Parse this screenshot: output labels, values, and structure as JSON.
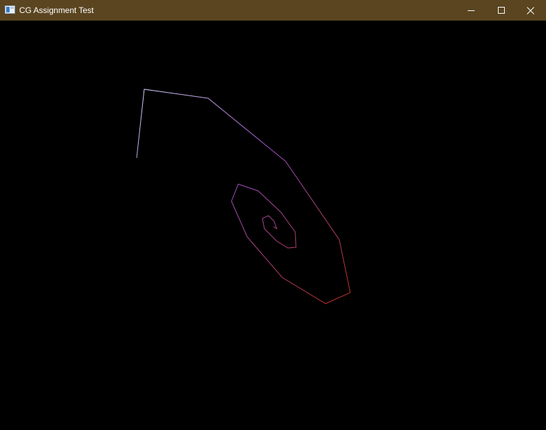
{
  "window": {
    "title": "CG Assignment Test",
    "titlebar_color": "#5a4520",
    "title_color": "#ffffff",
    "canvas_background": "#000000"
  },
  "controls": {
    "minimize_icon": "minimize-icon",
    "maximize_icon": "maximize-icon",
    "close_icon": "close-icon"
  },
  "drawing": {
    "stroke_start_color": "#d8d8ff",
    "stroke_mid_color": "#a050c8",
    "stroke_end_color": "#c03020"
  }
}
